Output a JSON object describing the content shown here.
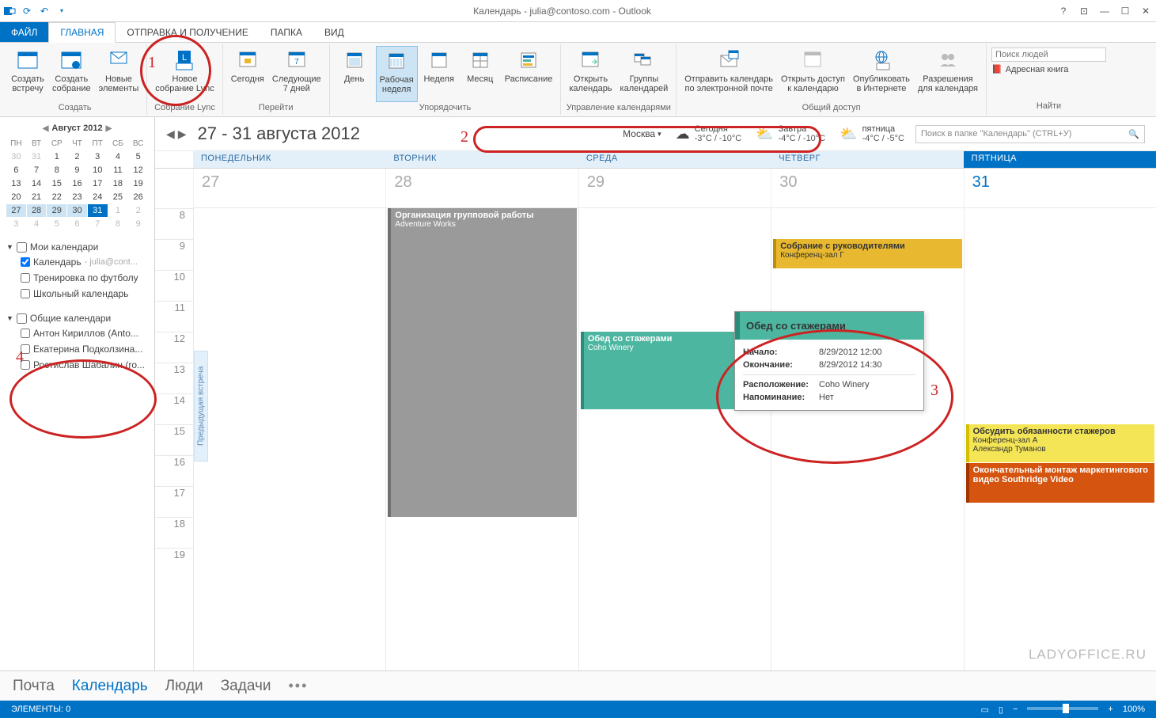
{
  "title_bar": {
    "title": "Календарь - julia@contoso.com - Outlook"
  },
  "tabs": {
    "file": "ФАЙЛ",
    "home": "ГЛАВНАЯ",
    "send_receive": "ОТПРАВКА И ПОЛУЧЕНИЕ",
    "folder": "ПАПКА",
    "view": "ВИД"
  },
  "ribbon": {
    "new_appointment": "Создать\nвстречу",
    "new_meeting": "Создать\nсобрание",
    "new_items": "Новые\nэлементы",
    "lync_meeting": "Новое\nсобрание Lync",
    "today": "Сегодня",
    "next_7": "Следующие\n7 дней",
    "day": "День",
    "work_week": "Рабочая\nнеделя",
    "week": "Неделя",
    "month": "Месяц",
    "schedule": "Расписание",
    "open_calendar": "Открыть\nкалендарь",
    "calendar_groups": "Группы\nкалендарей",
    "email_calendar": "Отправить календарь\nпо электронной почте",
    "share_calendar": "Открыть доступ\nк календарю",
    "publish_online": "Опубликовать\nв Интернете",
    "permissions": "Разрешения\nдля календаря",
    "g_create": "Создать",
    "g_lync": "Собрание Lync",
    "g_goto": "Перейти",
    "g_arrange": "Упорядочить",
    "g_manage": "Управление календарями",
    "g_share": "Общий доступ",
    "g_find": "Найти",
    "find_people": "Поиск людей",
    "address_book": "Адресная книга"
  },
  "mini_cal": {
    "title": "Август 2012",
    "weekdays": [
      "ПН",
      "ВТ",
      "СР",
      "ЧТ",
      "ПТ",
      "СБ",
      "ВС"
    ],
    "rows": [
      [
        {
          "d": "30",
          "o": true
        },
        {
          "d": "31",
          "o": true
        },
        {
          "d": "1"
        },
        {
          "d": "2"
        },
        {
          "d": "3"
        },
        {
          "d": "4"
        },
        {
          "d": "5"
        }
      ],
      [
        {
          "d": "6"
        },
        {
          "d": "7"
        },
        {
          "d": "8"
        },
        {
          "d": "9"
        },
        {
          "d": "10"
        },
        {
          "d": "11"
        },
        {
          "d": "12"
        }
      ],
      [
        {
          "d": "13"
        },
        {
          "d": "14"
        },
        {
          "d": "15"
        },
        {
          "d": "16"
        },
        {
          "d": "17"
        },
        {
          "d": "18"
        },
        {
          "d": "19"
        }
      ],
      [
        {
          "d": "20"
        },
        {
          "d": "21"
        },
        {
          "d": "22"
        },
        {
          "d": "23"
        },
        {
          "d": "24"
        },
        {
          "d": "25"
        },
        {
          "d": "26"
        }
      ],
      [
        {
          "d": "27",
          "sel": true
        },
        {
          "d": "28",
          "sel": true
        },
        {
          "d": "29",
          "sel": true
        },
        {
          "d": "30",
          "sel": true
        },
        {
          "d": "31",
          "today": true
        },
        {
          "d": "1",
          "o": true
        },
        {
          "d": "2",
          "o": true
        }
      ],
      [
        {
          "d": "3",
          "o": true
        },
        {
          "d": "4",
          "o": true
        },
        {
          "d": "5",
          "o": true
        },
        {
          "d": "6",
          "o": true
        },
        {
          "d": "7",
          "o": true
        },
        {
          "d": "8",
          "o": true
        },
        {
          "d": "9",
          "o": true
        }
      ]
    ]
  },
  "calendars": {
    "my_title": "Мои календари",
    "shared_title": "Общие календари",
    "my": [
      {
        "label": "Календарь",
        "acct": " - julia@cont...",
        "checked": true
      },
      {
        "label": "Тренировка по футболу",
        "checked": false
      },
      {
        "label": "Школьный календарь",
        "checked": false
      }
    ],
    "shared": [
      {
        "label": "Антон Кириллов (Anto...",
        "checked": false
      },
      {
        "label": "Екатерина Подколзина...",
        "checked": false
      },
      {
        "label": "Ростислав Шабалин (ro...",
        "checked": false
      }
    ]
  },
  "cal_view": {
    "range": "27 - 31 августа 2012",
    "location": "Москва",
    "weather": [
      {
        "day": "Сегодня",
        "temp": "-3°C / -10°C",
        "icon": "☁"
      },
      {
        "day": "Завтра",
        "temp": "-4°C / -10°C",
        "icon": "⛅"
      },
      {
        "day": "пятница",
        "temp": "-4°C / -5°C",
        "icon": "⛅"
      }
    ],
    "search_placeholder": "Поиск в папке \"Календарь\" (CTRL+У)",
    "day_names": [
      "ПОНЕДЕЛЬНИК",
      "ВТОРНИК",
      "СРЕДА",
      "ЧЕТВЕРГ",
      "ПЯТНИЦА"
    ],
    "dates": [
      "27",
      "28",
      "29",
      "30",
      "31"
    ],
    "hours": [
      "8",
      "9",
      "10",
      "11",
      "12",
      "13",
      "14",
      "15",
      "16",
      "17",
      "18",
      "19"
    ],
    "prev_label": "Предыдущая встреча"
  },
  "events": {
    "e1_title": "Организация групповой работы",
    "e1_loc": "Adventure Works",
    "e2_title": "Обед со стажерами",
    "e2_loc": "Coho Winery",
    "e3_title": "Собрание с руководителями",
    "e3_loc": "Конференц-зал Г",
    "e4_title": "Обсудить обязанности стажеров",
    "e4_loc": "Конференц-зал А",
    "e4_person": "Александр Туманов",
    "e5_title": "Окончательный монтаж маркетингового видео Southridge Video"
  },
  "popup": {
    "title": "Обед со стажерами",
    "start_lbl": "Начало:",
    "start_val": "8/29/2012   12:00",
    "end_lbl": "Окончание:",
    "end_val": "8/29/2012   14:30",
    "loc_lbl": "Расположение:",
    "loc_val": "Coho Winery",
    "rem_lbl": "Напоминание:",
    "rem_val": "Нет"
  },
  "nav": {
    "mail": "Почта",
    "calendar": "Календарь",
    "people": "Люди",
    "tasks": "Задачи"
  },
  "status": {
    "items": "ЭЛЕМЕНТЫ: 0",
    "zoom": "100%"
  },
  "watermark": "LADYOFFICE.RU",
  "callouts": {
    "c1": "1",
    "c2": "2",
    "c3": "3",
    "c4": "4"
  }
}
